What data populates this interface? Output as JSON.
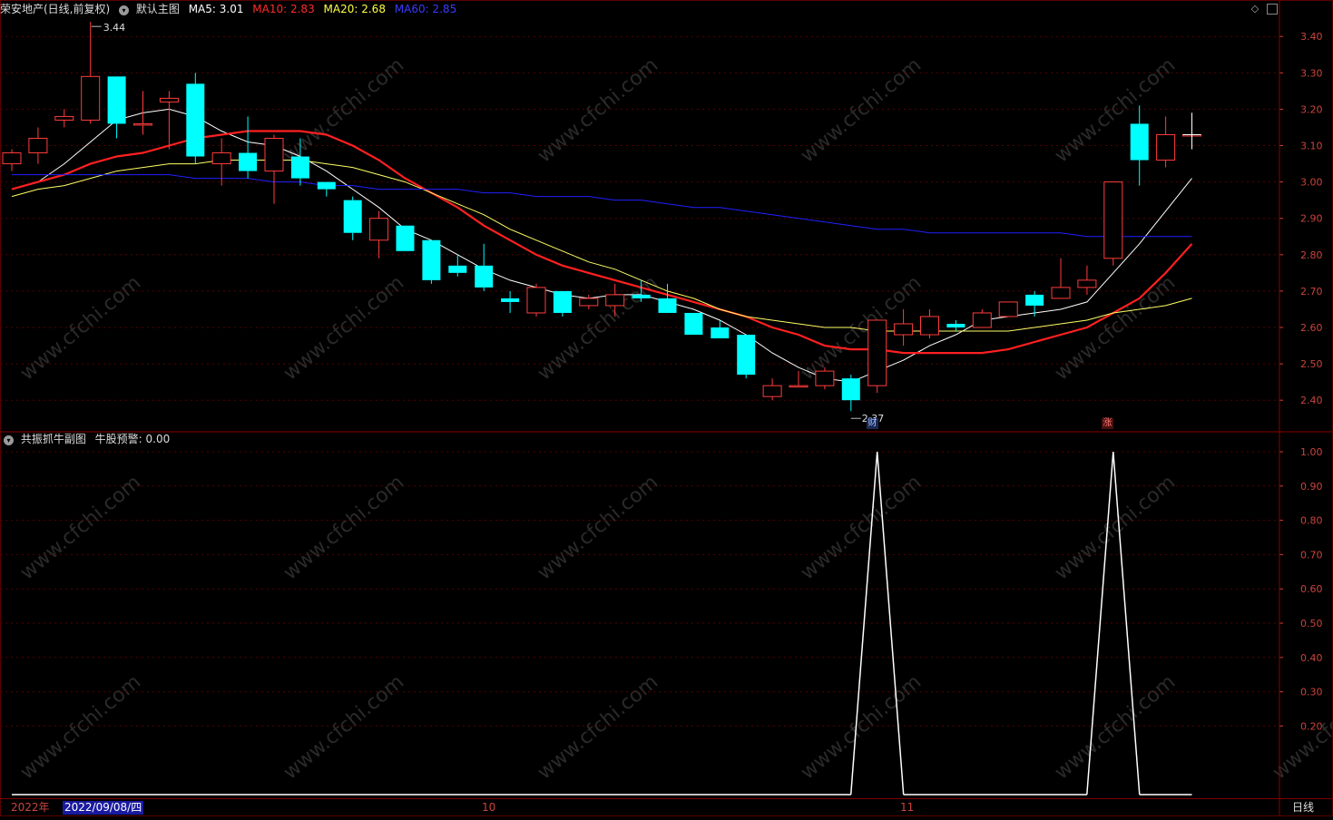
{
  "header": {
    "stock": "荣安地产(日线,前复权)",
    "main_chart_label": "默认主图",
    "ma5": "MA5: 3.01",
    "ma10": "MA10: 2.83",
    "ma20": "MA20: 2.68",
    "ma60": "MA60: 2.85"
  },
  "sub_header": {
    "indicator": "共振抓牛副图",
    "alert": "牛股预警: 0.00"
  },
  "colors": {
    "up": "#ff3c3c",
    "down": "#00ffff",
    "ma5": "#ffffff",
    "ma10": "#ff2020",
    "ma20": "#ffff66",
    "ma60": "#2020ff",
    "axis": "#c8443c",
    "grid": "#5a0000"
  },
  "icons": {
    "collapse": "collapse-circle-icon",
    "diamond": "diamond-icon",
    "panel": "panel-toggle-icon"
  },
  "price_axis": [
    "3.40",
    "3.30",
    "3.20",
    "3.10",
    "3.00",
    "2.90",
    "2.80",
    "2.70",
    "2.60",
    "2.50",
    "2.40"
  ],
  "indicator_axis": [
    "1.00",
    "0.90",
    "0.80",
    "0.70",
    "0.60",
    "0.50",
    "0.40",
    "0.30",
    "0.20"
  ],
  "annotations": {
    "high": "3.44",
    "low": "2.37",
    "marker_cai": "财",
    "marker_zhang": "涨"
  },
  "date_bar": {
    "year": "2022年",
    "cursor_date": "2022/09/08/四",
    "month_oct": "10",
    "month_nov": "11",
    "period": "日线"
  },
  "chart_data": [
    {
      "type": "candlestick",
      "title": "荣安地产(日线,前复权)",
      "ylim": [
        2.33,
        3.47
      ],
      "candles": [
        {
          "o": 3.05,
          "h": 3.09,
          "l": 3.03,
          "c": 3.08
        },
        {
          "o": 3.08,
          "h": 3.15,
          "l": 3.05,
          "c": 3.12
        },
        {
          "o": 3.17,
          "h": 3.2,
          "l": 3.15,
          "c": 3.18
        },
        {
          "o": 3.17,
          "h": 3.44,
          "l": 3.16,
          "c": 3.29
        },
        {
          "o": 3.29,
          "h": 3.29,
          "l": 3.12,
          "c": 3.16
        },
        {
          "o": 3.16,
          "h": 3.25,
          "l": 3.13,
          "c": 3.16
        },
        {
          "o": 3.22,
          "h": 3.25,
          "l": 3.09,
          "c": 3.23
        },
        {
          "o": 3.27,
          "h": 3.3,
          "l": 3.05,
          "c": 3.07
        },
        {
          "o": 3.05,
          "h": 3.12,
          "l": 2.99,
          "c": 3.08
        },
        {
          "o": 3.08,
          "h": 3.18,
          "l": 3.01,
          "c": 3.03
        },
        {
          "o": 3.03,
          "h": 3.13,
          "l": 2.94,
          "c": 3.12
        },
        {
          "o": 3.07,
          "h": 3.12,
          "l": 2.99,
          "c": 3.01
        },
        {
          "o": 3.0,
          "h": 3.0,
          "l": 2.96,
          "c": 2.98
        },
        {
          "o": 2.95,
          "h": 2.96,
          "l": 2.84,
          "c": 2.86
        },
        {
          "o": 2.84,
          "h": 2.92,
          "l": 2.79,
          "c": 2.9
        },
        {
          "o": 2.88,
          "h": 2.88,
          "l": 2.81,
          "c": 2.81
        },
        {
          "o": 2.84,
          "h": 2.84,
          "l": 2.72,
          "c": 2.73
        },
        {
          "o": 2.77,
          "h": 2.8,
          "l": 2.74,
          "c": 2.75
        },
        {
          "o": 2.77,
          "h": 2.83,
          "l": 2.7,
          "c": 2.71
        },
        {
          "o": 2.68,
          "h": 2.7,
          "l": 2.64,
          "c": 2.67
        },
        {
          "o": 2.64,
          "h": 2.72,
          "l": 2.63,
          "c": 2.71
        },
        {
          "o": 2.7,
          "h": 2.7,
          "l": 2.63,
          "c": 2.64
        },
        {
          "o": 2.66,
          "h": 2.69,
          "l": 2.65,
          "c": 2.68
        },
        {
          "o": 2.66,
          "h": 2.72,
          "l": 2.63,
          "c": 2.69
        },
        {
          "o": 2.69,
          "h": 2.73,
          "l": 2.67,
          "c": 2.68
        },
        {
          "o": 2.68,
          "h": 2.72,
          "l": 2.64,
          "c": 2.64
        },
        {
          "o": 2.64,
          "h": 2.64,
          "l": 2.58,
          "c": 2.58
        },
        {
          "o": 2.6,
          "h": 2.62,
          "l": 2.57,
          "c": 2.57
        },
        {
          "o": 2.58,
          "h": 2.58,
          "l": 2.46,
          "c": 2.47
        },
        {
          "o": 2.41,
          "h": 2.46,
          "l": 2.4,
          "c": 2.44
        },
        {
          "o": 2.44,
          "h": 2.48,
          "l": 2.44,
          "c": 2.44
        },
        {
          "o": 2.44,
          "h": 2.49,
          "l": 2.43,
          "c": 2.48
        },
        {
          "o": 2.46,
          "h": 2.47,
          "l": 2.37,
          "c": 2.4
        },
        {
          "o": 2.44,
          "h": 2.62,
          "l": 2.42,
          "c": 2.62
        },
        {
          "o": 2.58,
          "h": 2.65,
          "l": 2.55,
          "c": 2.61
        },
        {
          "o": 2.58,
          "h": 2.65,
          "l": 2.57,
          "c": 2.63
        },
        {
          "o": 2.61,
          "h": 2.62,
          "l": 2.59,
          "c": 2.6
        },
        {
          "o": 2.6,
          "h": 2.65,
          "l": 2.6,
          "c": 2.64
        },
        {
          "o": 2.63,
          "h": 2.67,
          "l": 2.63,
          "c": 2.67
        },
        {
          "o": 2.69,
          "h": 2.7,
          "l": 2.63,
          "c": 2.66
        },
        {
          "o": 2.68,
          "h": 2.79,
          "l": 2.68,
          "c": 2.71
        },
        {
          "o": 2.71,
          "h": 2.77,
          "l": 2.69,
          "c": 2.73
        },
        {
          "o": 2.79,
          "h": 3.0,
          "l": 2.77,
          "c": 3.0
        },
        {
          "o": 3.16,
          "h": 3.21,
          "l": 2.99,
          "c": 3.06
        },
        {
          "o": 3.06,
          "h": 3.18,
          "l": 3.04,
          "c": 3.13
        },
        {
          "o": 3.13,
          "h": 3.19,
          "l": 3.09,
          "c": 3.13
        }
      ],
      "series": [
        {
          "name": "MA5",
          "values": [
            2.98,
            3.0,
            3.05,
            3.11,
            3.17,
            3.19,
            3.2,
            3.18,
            3.14,
            3.11,
            3.1,
            3.07,
            3.03,
            2.98,
            2.93,
            2.87,
            2.84,
            2.8,
            2.76,
            2.73,
            2.71,
            2.69,
            2.68,
            2.69,
            2.69,
            2.67,
            2.65,
            2.62,
            2.58,
            2.53,
            2.49,
            2.46,
            2.45,
            2.48,
            2.51,
            2.55,
            2.58,
            2.62,
            2.63,
            2.64,
            2.65,
            2.67,
            2.75,
            2.83,
            2.92,
            3.01
          ]
        },
        {
          "name": "MA10",
          "values": [
            2.98,
            3.0,
            3.02,
            3.05,
            3.07,
            3.08,
            3.1,
            3.12,
            3.13,
            3.14,
            3.14,
            3.14,
            3.13,
            3.1,
            3.06,
            3.01,
            2.97,
            2.93,
            2.88,
            2.84,
            2.8,
            2.77,
            2.75,
            2.73,
            2.71,
            2.69,
            2.67,
            2.65,
            2.63,
            2.6,
            2.58,
            2.55,
            2.54,
            2.54,
            2.53,
            2.53,
            2.53,
            2.53,
            2.54,
            2.56,
            2.58,
            2.6,
            2.64,
            2.68,
            2.75,
            2.83
          ]
        },
        {
          "name": "MA20",
          "values": [
            2.96,
            2.98,
            2.99,
            3.01,
            3.03,
            3.04,
            3.05,
            3.05,
            3.06,
            3.06,
            3.06,
            3.06,
            3.05,
            3.04,
            3.02,
            3.0,
            2.97,
            2.94,
            2.91,
            2.87,
            2.84,
            2.81,
            2.78,
            2.76,
            2.73,
            2.7,
            2.68,
            2.65,
            2.63,
            2.62,
            2.61,
            2.6,
            2.6,
            2.59,
            2.59,
            2.59,
            2.59,
            2.59,
            2.59,
            2.6,
            2.61,
            2.62,
            2.64,
            2.65,
            2.66,
            2.68
          ]
        },
        {
          "name": "MA60",
          "values": [
            3.02,
            3.02,
            3.02,
            3.02,
            3.02,
            3.02,
            3.02,
            3.01,
            3.01,
            3.01,
            3.0,
            3.0,
            2.99,
            2.99,
            2.98,
            2.98,
            2.98,
            2.98,
            2.97,
            2.97,
            2.96,
            2.96,
            2.96,
            2.95,
            2.95,
            2.94,
            2.93,
            2.93,
            2.92,
            2.91,
            2.9,
            2.89,
            2.88,
            2.87,
            2.87,
            2.86,
            2.86,
            2.86,
            2.86,
            2.86,
            2.86,
            2.85,
            2.85,
            2.85,
            2.85,
            2.85
          ]
        }
      ]
    },
    {
      "type": "line",
      "title": "共振抓牛副图",
      "ylim": [
        0,
        1.0
      ],
      "series": [
        {
          "name": "牛股预警",
          "values": [
            0,
            0,
            0,
            0,
            0,
            0,
            0,
            0,
            0,
            0,
            0,
            0,
            0,
            0,
            0,
            0,
            0,
            0,
            0,
            0,
            0,
            0,
            0,
            0,
            0,
            0,
            0,
            0,
            0,
            0,
            0,
            0,
            0,
            1,
            0,
            0,
            0,
            0,
            0,
            0,
            0,
            0,
            1,
            0,
            0,
            0
          ]
        }
      ]
    }
  ]
}
